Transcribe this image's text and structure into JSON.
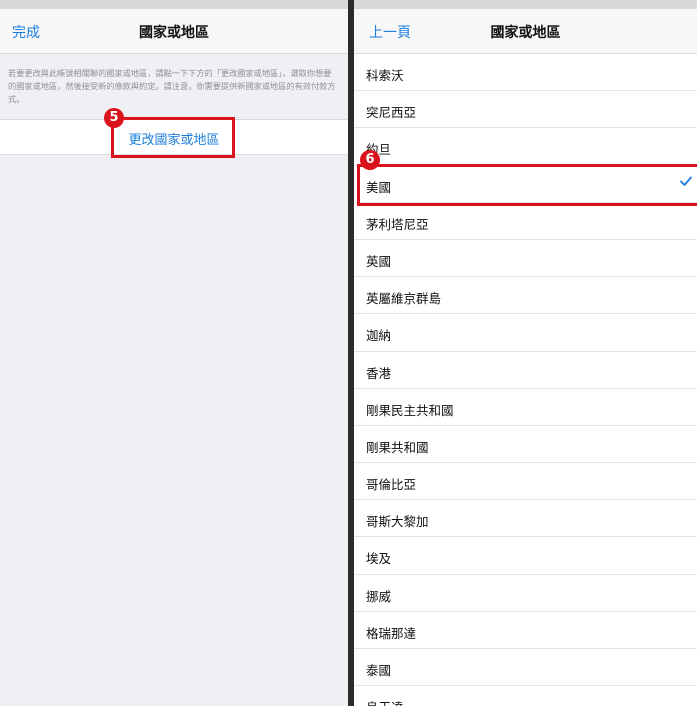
{
  "left_screen": {
    "nav": {
      "done_label": "完成",
      "title": "國家或地區"
    },
    "description": "若要更改與此帳號相關聯的國家或地區，請點一下下方的「更改國家或地區」，選取你想要的國家或地區，然後接受新的條款與約定。請注意，你需要提供新國家或地區的有效付款方式。",
    "action_label": "更改國家或地區",
    "step_badge": "5"
  },
  "right_screen": {
    "nav": {
      "back_label": "上一頁",
      "title": "國家或地區"
    },
    "step_badge": "6",
    "selected_country": "美國",
    "countries": [
      "科索沃",
      "突尼西亞",
      "約旦",
      "美國",
      "茅利塔尼亞",
      "英國",
      "英屬維京群島",
      "迦納",
      "香港",
      "剛果民主共和國",
      "剛果共和國",
      "哥倫比亞",
      "哥斯大黎加",
      "埃及",
      "挪威",
      "格瑞那達",
      "泰國",
      "烏干達"
    ]
  },
  "colors": {
    "accent": "#1a7fdc",
    "highlight": "#d9121b",
    "check": "#1a7fdc"
  },
  "icons": {
    "selected": "checkmark-icon"
  }
}
